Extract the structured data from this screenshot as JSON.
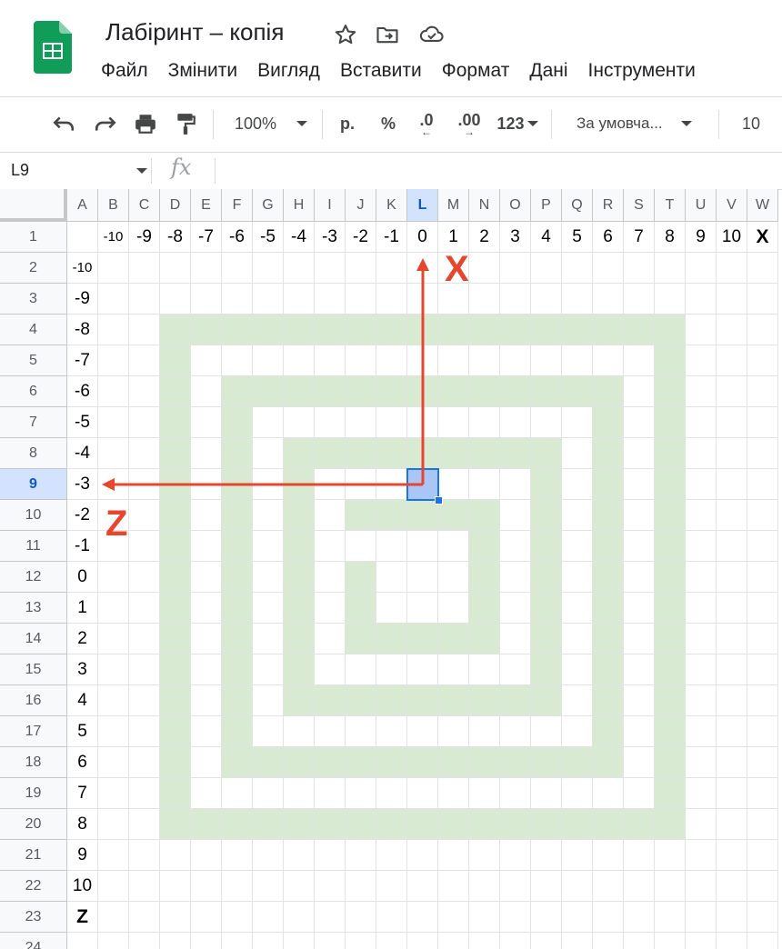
{
  "app": {
    "doc_title": "Лабіринт – копія",
    "menu": [
      "Файл",
      "Змінити",
      "Вигляд",
      "Вставити",
      "Формат",
      "Дані",
      "Інструменти"
    ],
    "icons": {
      "logo": "sheets-logo-icon",
      "star": "star-icon",
      "move": "move-to-folder-icon",
      "cloud": "cloud-saved-icon"
    }
  },
  "toolbar": {
    "zoom": "100%",
    "currency": "р.",
    "percent": "%",
    "decrease_decimals": ".0",
    "increase_decimals": ".00",
    "number_format": "123",
    "font": "За умовча...",
    "font_size": "10",
    "icons": [
      "undo-icon",
      "redo-icon",
      "print-icon",
      "paint-format-icon"
    ]
  },
  "formula_bar": {
    "cell_ref": "L9",
    "fx": "fx",
    "value": ""
  },
  "sheet": {
    "columns": [
      "A",
      "B",
      "C",
      "D",
      "E",
      "F",
      "G",
      "H",
      "I",
      "J",
      "K",
      "L",
      "M",
      "N",
      "O",
      "P",
      "Q",
      "R",
      "S",
      "T",
      "U",
      "V",
      "W"
    ],
    "rows": [
      "1",
      "2",
      "3",
      "4",
      "5",
      "6",
      "7",
      "8",
      "9",
      "10",
      "11",
      "12",
      "13",
      "14",
      "15",
      "16",
      "17",
      "18",
      "19",
      "20",
      "21",
      "22",
      "23",
      "24"
    ],
    "selected_cell": "L9",
    "row1_values": [
      "",
      "-10",
      "-9",
      "-8",
      "-7",
      "-6",
      "-5",
      "-4",
      "-3",
      "-2",
      "-1",
      "0",
      "1",
      "2",
      "3",
      "4",
      "5",
      "6",
      "7",
      "8",
      "9",
      "10",
      "X"
    ],
    "colA_values": [
      "",
      "-10",
      "-9",
      "-8",
      "-7",
      "-6",
      "-5",
      "-4",
      "-3",
      "-2",
      "-1",
      "0",
      "1",
      "2",
      "3",
      "4",
      "5",
      "6",
      "7",
      "8",
      "9",
      "10",
      "Z",
      ""
    ],
    "maze_cells": [
      "D4:T4",
      "D4:D20",
      "T4:T20",
      "D20:T20",
      "F6:R6",
      "F6:F18",
      "R6:R18",
      "F18:R18",
      "H8:P8",
      "H8:H16",
      "P8:P16",
      "H16:P16",
      "J10:N10",
      "N10:N14",
      "J12:J14",
      "J14:N14"
    ],
    "fill_color": "#d9ead3",
    "selection_color": "#1a73e8"
  },
  "annotations": {
    "x_label": "X",
    "z_label": "Z",
    "arrow_color": "#e8452c"
  }
}
